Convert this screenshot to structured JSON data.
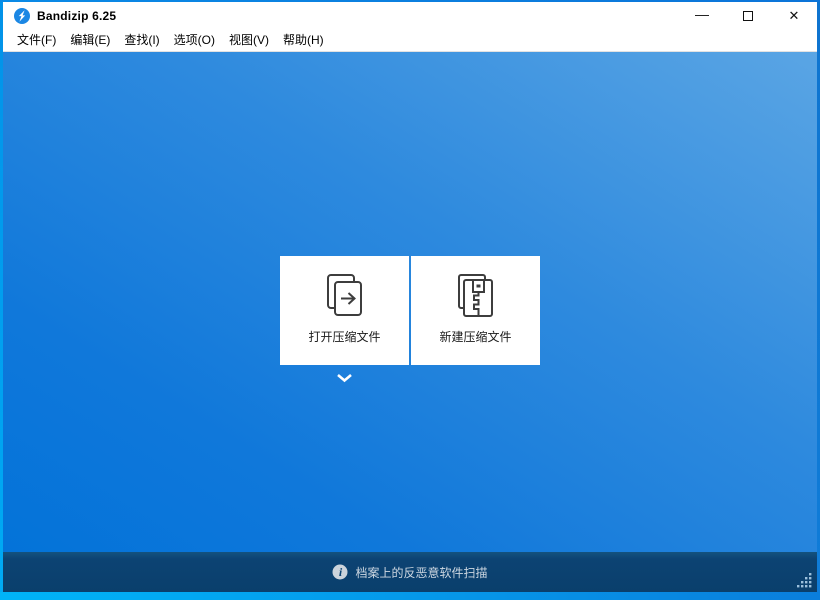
{
  "window": {
    "title": "Bandizip 6.25",
    "app_icon": "bandizip-logo",
    "controls": {
      "minimize_glyph": "—",
      "close_glyph": "✕"
    }
  },
  "menu": {
    "items": [
      "文件(F)",
      "编辑(E)",
      "查找(I)",
      "选项(O)",
      "视图(V)",
      "帮助(H)"
    ]
  },
  "main": {
    "tiles": [
      {
        "id": "open-archive",
        "icon": "open-archive-icon",
        "label": "打开压缩文件"
      },
      {
        "id": "new-archive",
        "icon": "new-archive-icon",
        "label": "新建压缩文件"
      }
    ],
    "expander_icon": "chevron-down-icon"
  },
  "statusbar": {
    "icon": "info-icon",
    "message": "档案上的反恶意软件扫描"
  },
  "colors": {
    "titlebar_bg": "#ffffff",
    "bg_gradient_light": "#5aa5e4",
    "bg_gradient_dark": "#0373d9",
    "statusbar_bg": "#0c4373",
    "border_left_blue": "#00aaf4",
    "bottom_strip_left": "#00b4f8",
    "bottom_strip_right": "#0a7edc",
    "icon_stroke": "#3d3d3d",
    "status_text": "#cdd7e1"
  }
}
